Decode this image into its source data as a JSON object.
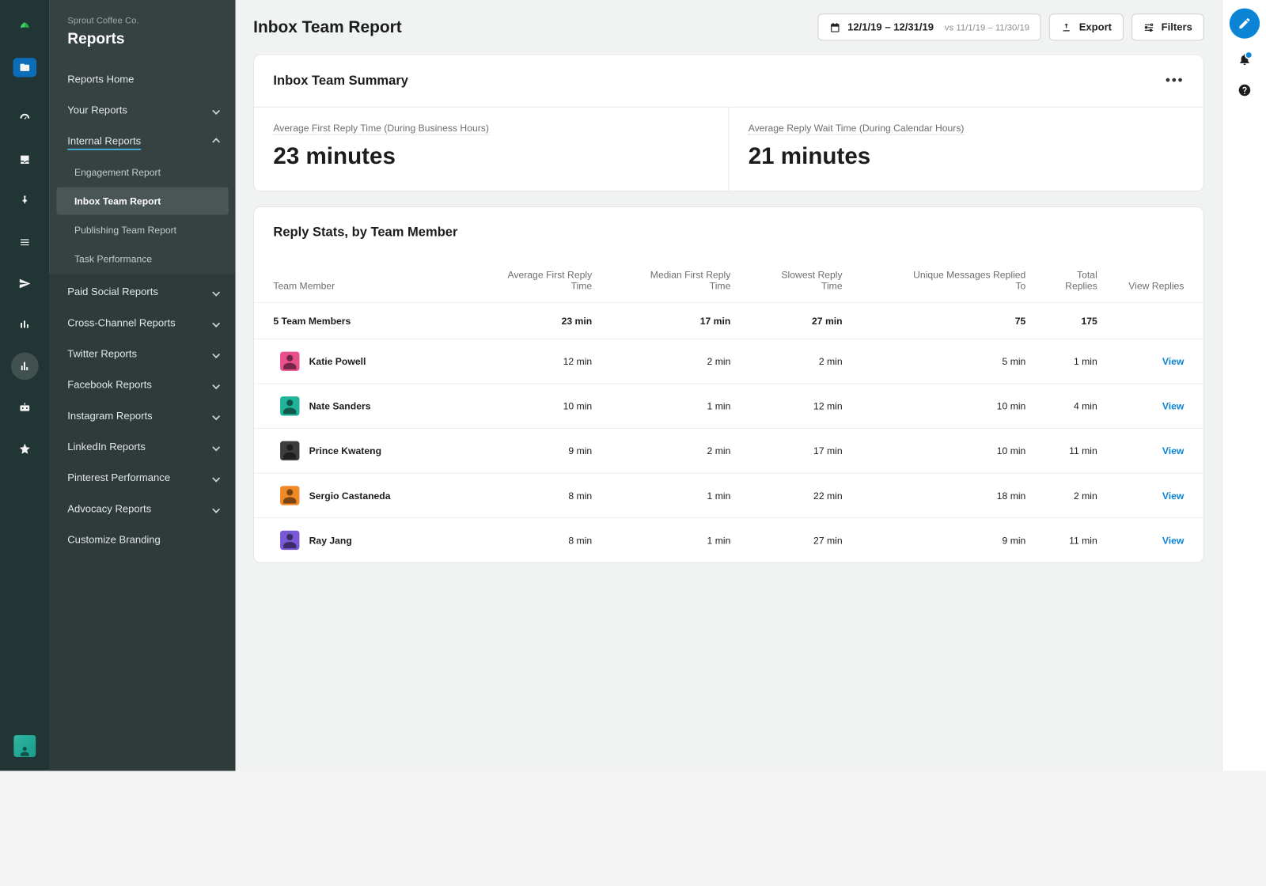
{
  "org": "Sprout Coffee Co.",
  "section": "Reports",
  "page_title": "Inbox Team Report",
  "date_picker": {
    "range": "12/1/19 – 12/31/19",
    "compare_prefix": "vs",
    "compare_range": "11/1/19 – 11/30/19"
  },
  "export_label": "Export",
  "filters_label": "Filters",
  "sidebar": {
    "top": [
      {
        "label": "Reports Home",
        "collapsible": false
      },
      {
        "label": "Your Reports",
        "collapsible": true,
        "expanded": false
      },
      {
        "label": "Internal Reports",
        "collapsible": true,
        "expanded": true,
        "selected": true
      }
    ],
    "internal_sub": [
      {
        "label": "Engagement Report"
      },
      {
        "label": "Inbox Team Report",
        "active": true
      },
      {
        "label": "Publishing Team Report"
      },
      {
        "label": "Task Performance"
      }
    ],
    "bottom": [
      {
        "label": "Paid Social Reports",
        "collapsible": true
      },
      {
        "label": "Cross-Channel Reports",
        "collapsible": true
      },
      {
        "label": "Twitter Reports",
        "collapsible": true
      },
      {
        "label": "Facebook Reports",
        "collapsible": true
      },
      {
        "label": "Instagram Reports",
        "collapsible": true
      },
      {
        "label": "LinkedIn Reports",
        "collapsible": true
      },
      {
        "label": "Pinterest Performance",
        "collapsible": true
      },
      {
        "label": "Advocacy Reports",
        "collapsible": true
      },
      {
        "label": "Customize Branding",
        "collapsible": false
      }
    ]
  },
  "summary_card": {
    "title": "Inbox Team Summary",
    "metrics": [
      {
        "label": "Average First Reply Time (During Business Hours)",
        "value": "23 minutes"
      },
      {
        "label": "Average Reply Wait Time (During Calendar Hours)",
        "value": "21 minutes"
      }
    ]
  },
  "reply_stats": {
    "title": "Reply Stats, by Team Member",
    "columns": [
      "Team Member",
      "Average First Reply Time",
      "Median First Reply Time",
      "Slowest Reply Time",
      "Unique Messages Replied To",
      "Total Replies",
      "View Replies"
    ],
    "totals": {
      "label": "5 Team Members",
      "avg_first": "23 min",
      "median_first": "17 min",
      "slowest": "27 min",
      "unique": "75",
      "total": "175"
    },
    "rows": [
      {
        "name": "Katie Powell",
        "avatar": "#e84f8b",
        "avg_first": "12 min",
        "median_first": "2 min",
        "slowest": "2 min",
        "unique": "5 min",
        "total": "1 min",
        "view": "View"
      },
      {
        "name": "Nate Sanders",
        "avatar": "#20b59a",
        "avg_first": "10 min",
        "median_first": "1 min",
        "slowest": "12 min",
        "unique": "10 min",
        "total": "4 min",
        "view": "View"
      },
      {
        "name": "Prince Kwateng",
        "avatar": "#3d3d3d",
        "avg_first": "9 min",
        "median_first": "2 min",
        "slowest": "17 min",
        "unique": "10 min",
        "total": "11 min",
        "view": "View"
      },
      {
        "name": "Sergio Castaneda",
        "avatar": "#f08a26",
        "avg_first": "8 min",
        "median_first": "1 min",
        "slowest": "22 min",
        "unique": "18 min",
        "total": "2 min",
        "view": "View"
      },
      {
        "name": "Ray Jang",
        "avatar": "#7a59d6",
        "avg_first": "8 min",
        "median_first": "1 min",
        "slowest": "27 min",
        "unique": "9 min",
        "total": "11 min",
        "view": "View"
      }
    ]
  }
}
